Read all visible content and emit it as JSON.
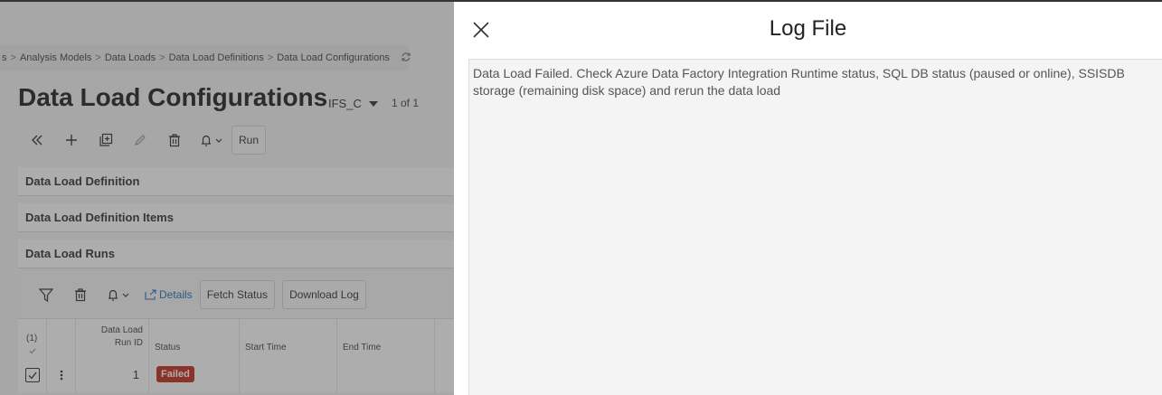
{
  "breadcrumb": {
    "items": [
      "s",
      "Analysis Models",
      "Data Loads",
      "Data Load Definitions",
      "Data Load Configurations"
    ],
    "separator": ">"
  },
  "page": {
    "title": "Data Load Configurations",
    "company": "IFS_C",
    "pager": "1 of 1"
  },
  "toolbar": {
    "run_label": "Run"
  },
  "sections": {
    "definition": "Data Load Definition",
    "items": "Data Load Definition Items",
    "runs": "Data Load Runs"
  },
  "grid": {
    "details_label": "Details",
    "fetch_status_label": "Fetch Status",
    "download_log_label": "Download Log",
    "selected_count": "(1)",
    "columns": {
      "run_id_line1": "Data Load",
      "run_id_line2": "Run ID",
      "status": "Status",
      "start_time": "Start Time",
      "end_time": "End Time"
    },
    "rows": [
      {
        "run_id": "1",
        "status": "Failed",
        "start_time": "",
        "end_time": ""
      }
    ]
  },
  "log_panel": {
    "title": "Log File",
    "message": "Data Load Failed. Check Azure Data Factory Integration Runtime status, SQL DB status (paused or online), SSISDB storage (remaining disk space) and rerun the data load"
  },
  "colors": {
    "failed_badge": "#c42b1c",
    "link_blue": "#1f6fb5",
    "overlay": "#3c3c3c"
  }
}
